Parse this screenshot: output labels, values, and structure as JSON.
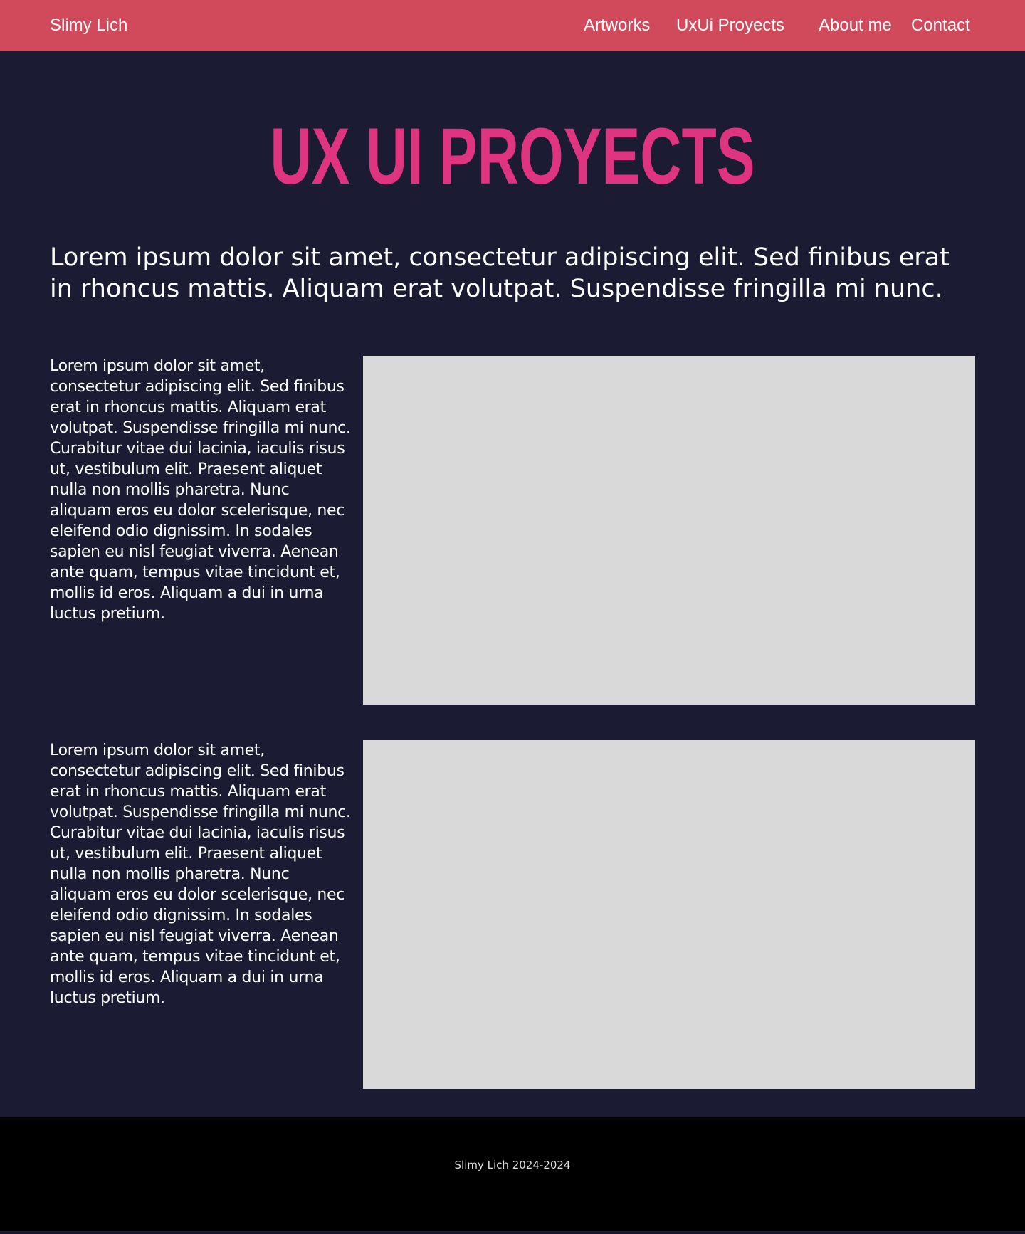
{
  "header": {
    "brand": "Slimy Lich",
    "nav": [
      {
        "label": "Artworks"
      },
      {
        "label": "UxUi Proyects"
      },
      {
        "label": "About me"
      },
      {
        "label": "Contact"
      }
    ]
  },
  "hero": {
    "title": "UX UI PROYECTS"
  },
  "intro": "Lorem ipsum dolor sit amet, consectetur adipiscing elit. Sed finibus erat in rhoncus mattis. Aliquam erat volutpat. Suspendisse fringilla mi nunc.",
  "projects": [
    {
      "description": "Lorem ipsum dolor sit amet, consectetur adipiscing elit. Sed finibus erat in rhoncus mattis. Aliquam erat volutpat. Suspendisse fringilla mi nunc. Curabitur vitae dui lacinia, iaculis risus ut, vestibulum elit. Praesent aliquet nulla non mollis pharetra. Nunc aliquam eros eu dolor scelerisque, nec eleifend odio dignissim. In sodales sapien eu nisl feugiat viverra. Aenean ante quam, tempus vitae tincidunt et, mollis id eros. Aliquam a dui in urna luctus pretium."
    },
    {
      "description": "Lorem ipsum dolor sit amet, consectetur adipiscing elit. Sed finibus erat in rhoncus mattis. Aliquam erat volutpat. Suspendisse fringilla mi nunc. Curabitur vitae dui lacinia, iaculis risus ut, vestibulum elit. Praesent aliquet nulla non mollis pharetra. Nunc aliquam eros eu dolor scelerisque, nec eleifend odio dignissim. In sodales sapien eu nisl feugiat viverra. Aenean ante quam, tempus vitae tincidunt et, mollis id eros. Aliquam a dui in urna luctus pretium."
    }
  ],
  "footer": {
    "text": "Slimy Lich 2024-2024"
  },
  "colors": {
    "navbar": "#d04a5b",
    "background": "#1b1b33",
    "accent": "#df3580",
    "placeholder": "#d9d9d9",
    "footer": "#000000"
  }
}
